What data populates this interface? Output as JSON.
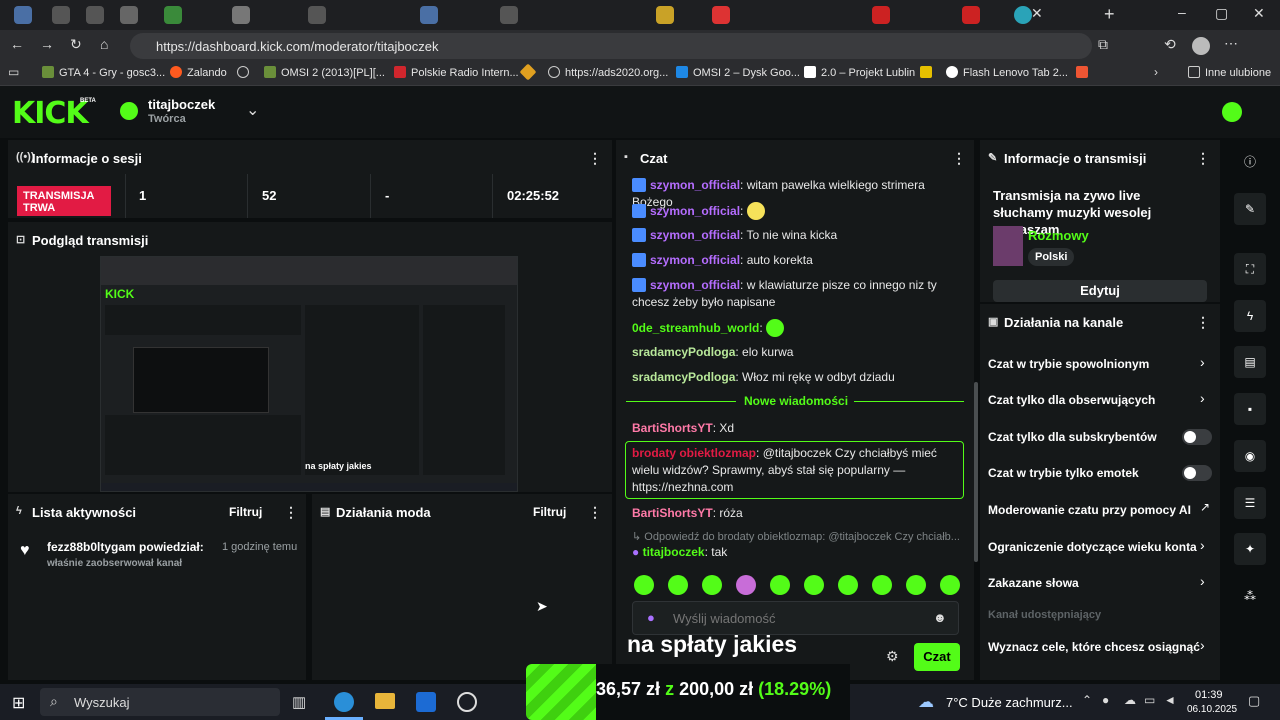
{
  "browser": {
    "url": "https://dashboard.kick.com/moderator/titajboczek",
    "bookmarks": [
      "GTA 4 - Gry - gosc3...",
      "Zalando",
      "OMSI 2 (2013)[PL][...",
      "Polskie Radio Intern...",
      "https://ads2020.org...",
      "OMSI 2 – Dysk Goo...",
      "2.0 – Projekt Lublin",
      "Flash Lenovo Tab 2...",
      "Inne ulubione"
    ]
  },
  "header": {
    "logo": "KICK",
    "beta": "BETA",
    "channel_name": "titajboczek",
    "channel_role": "Twórca"
  },
  "session": {
    "title": "Informacje o sesji",
    "live_badge": "TRANSMISJA TRWA",
    "stat1": "1",
    "stat2": "52",
    "stat3": "-",
    "time": "02:25:52"
  },
  "preview": {
    "title": "Podgląd transmisji",
    "overlay_text": "na spłaty jakies"
  },
  "activity": {
    "title": "Lista aktywności",
    "filter": "Filtruj",
    "item_user": "fezz88b0ltygam powiedział:",
    "item_time": "1 godzinę temu",
    "item_sub": "właśnie zaobserwował kanał"
  },
  "modactions": {
    "title": "Działania moda",
    "filter": "Filtruj"
  },
  "chat": {
    "title": "Czat",
    "messages": [
      {
        "user": "szymon_official",
        "text": "witam pawelka wielkiego strimera Bożego"
      },
      {
        "user": "szymon_official",
        "text": ""
      },
      {
        "user": "szymon_official",
        "text": "To nie wina kicka"
      },
      {
        "user": "szymon_official",
        "text": "auto korekta"
      },
      {
        "user": "szymon_official",
        "text": "w klawiaturze pisze co innego niz ty chcesz żeby było napisane"
      },
      {
        "user": "0de_streamhub_world",
        "text": ""
      },
      {
        "user": "sradamcyPodloga",
        "text": "elo kurwa"
      },
      {
        "user": "sradamcyPodloga",
        "text": "Włoz mi rękę w odbyt dziadu"
      }
    ],
    "new_messages": "Nowe wiadomości",
    "after": [
      {
        "user": "BartiShortsYT",
        "text": "Xd"
      },
      {
        "user": "brodaty obiektlozmap",
        "text": "@titajboczek Czy chciałbyś mieć wielu widzów? Sprawmy, abyś stał się popularny — https://nezhna.com"
      },
      {
        "user": "BartiShortsYT",
        "text": "róża"
      }
    ],
    "reply_to": "Odpowiedź do brodaty obiektlozmap: @titajboczek Czy chciałb...",
    "reply_user": "titajboczek",
    "reply_text": "tak",
    "input_placeholder": "Wyślij wiadomość",
    "send_button": "Czat",
    "overlay_text": "na spłaty jakies"
  },
  "stream_info": {
    "title": "Informacje o transmisji",
    "stream_title": "Transmisja na zywo live słuchamy muzyki wesolej zapraszam",
    "category": "Rozmowy",
    "language": "Polski",
    "edit_button": "Edytuj"
  },
  "channel_actions": {
    "title": "Działania na kanale",
    "items": [
      "Czat w trybie spowolnionym",
      "Czat tylko dla obserwujących",
      "Czat tylko dla subskrybentów",
      "Czat w trybie tylko emotek",
      "Moderowanie czatu przy pomocy AI",
      "Ograniczenie dotyczące wieku konta",
      "Zakazane słowa",
      "Kanał udostępniający",
      "Wyznacz cele, które chcesz osiągnąć"
    ]
  },
  "goal": {
    "current": "36,57 zł",
    "sep": "z",
    "target": "200,00 zł",
    "percent": "(18.29%)",
    "progress": 0.1829
  },
  "taskbar": {
    "search": "Wyszukaj",
    "weather": "7°C  Duże zachmurz...",
    "time": "01:39",
    "date": "06.10.2025"
  },
  "colors": {
    "accent": "#53fc18",
    "live": "#e21b44",
    "panel": "#151819"
  }
}
